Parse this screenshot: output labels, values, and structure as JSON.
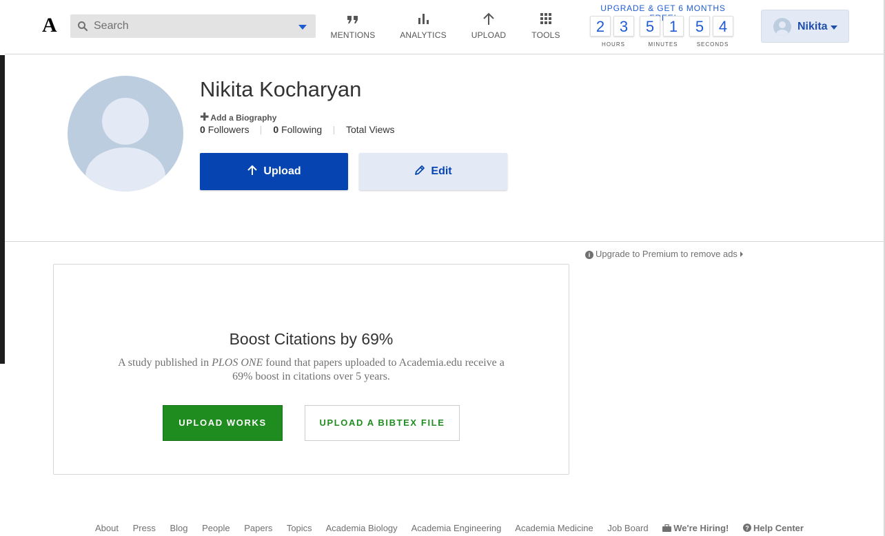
{
  "header": {
    "logo_text": "A",
    "search": {
      "placeholder": "Search"
    },
    "nav": [
      {
        "label": "MENTIONS",
        "icon": "quote-icon"
      },
      {
        "label": "ANALYTICS",
        "icon": "bar-chart-icon"
      },
      {
        "label": "UPLOAD",
        "icon": "arrow-up-icon"
      },
      {
        "label": "TOOLS",
        "icon": "grid-icon"
      }
    ],
    "promo": {
      "title": "UPGRADE & GET 6 MONTHS FREE!",
      "digits": [
        "2",
        "3",
        "5",
        "1",
        "5",
        "4"
      ],
      "labels": {
        "hours": "HOURS",
        "minutes": "MINUTES",
        "seconds": "SECONDS"
      }
    },
    "user": {
      "name": "Nikita"
    }
  },
  "profile": {
    "name": "Nikita Kocharyan",
    "add_bio": "Add a Biography",
    "followers_count": "0",
    "followers_label": "Followers",
    "following_count": "0",
    "following_label": "Following",
    "views_label": "Total Views",
    "upload_label": "Upload",
    "edit_label": "Edit"
  },
  "ads": {
    "premium_note": "Upgrade to Premium to remove ads"
  },
  "boost": {
    "title": "Boost Citations by 69%",
    "text_before": "A study published in ",
    "text_italic": "PLOS ONE",
    "text_after": " found that papers uploaded to Academia.edu receive a 69% boost in citations over 5 years.",
    "upload_works": "UPLOAD WORKS",
    "upload_bibtex": "UPLOAD A BIBTEX FILE"
  },
  "footer": {
    "links": [
      "About",
      "Press",
      "Blog",
      "People",
      "Papers",
      "Topics",
      "Academia Biology",
      "Academia Engineering",
      "Academia Medicine",
      "Job Board"
    ],
    "hiring": "We're Hiring!",
    "help": "Help Center"
  },
  "colors": {
    "brand_blue": "#0645b1",
    "accent_blue": "#1f5bd3",
    "green": "#1e8c1e",
    "avatar_bg": "#bccde0"
  }
}
